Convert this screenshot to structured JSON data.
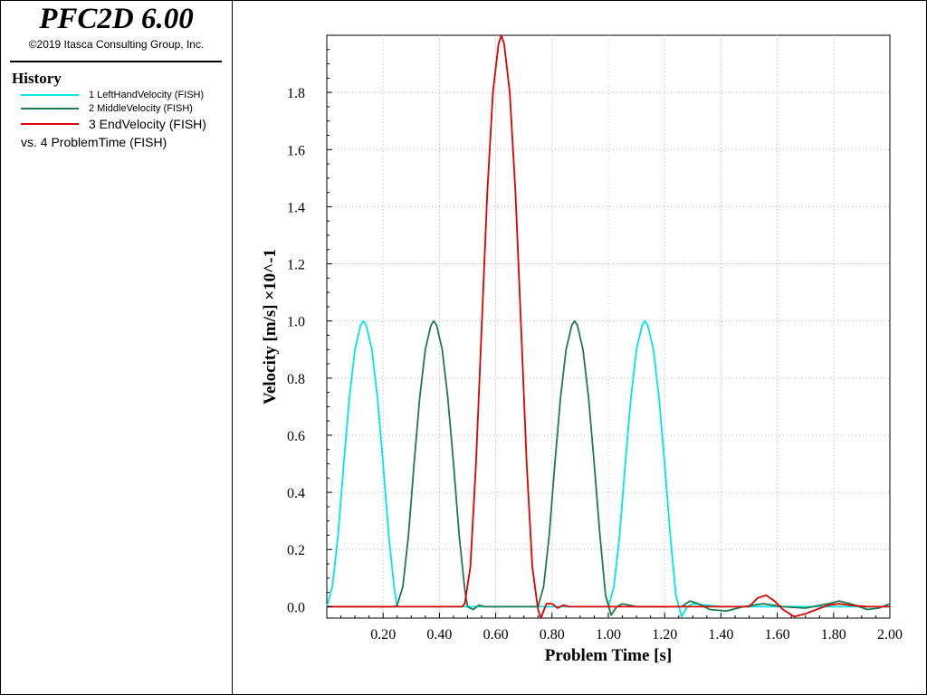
{
  "header": {
    "app_title": "PFC2D 6.00",
    "copyright": "©2019 Itasca Consulting Group, Inc."
  },
  "legend": {
    "heading": "History",
    "items": [
      {
        "label": "1 LeftHandVelocity (FISH)",
        "color": "#00e5e5"
      },
      {
        "label": "2 MiddleVelocity (FISH)",
        "color": "#1f7a4c"
      },
      {
        "label": "3 EndVelocity (FISH)",
        "color": "#dd0000"
      }
    ],
    "vs_label": "vs. 4 ProblemTime (FISH)"
  },
  "chart_data": {
    "type": "line",
    "xlabel": "Problem Time [s]",
    "ylabel": "Velocity [m/s] ×10^-1",
    "xlim": [
      0,
      2.0
    ],
    "ylim": [
      -0.04,
      2.0
    ],
    "x_ticks": [
      "0.20",
      "0.40",
      "0.60",
      "0.80",
      "1.00",
      "1.20",
      "1.40",
      "1.60",
      "1.80",
      "2.00"
    ],
    "y_ticks": [
      "0.0",
      "0.2",
      "0.4",
      "0.6",
      "0.8",
      "1.0",
      "1.2",
      "1.4",
      "1.6",
      "1.8"
    ],
    "grid": true,
    "series": [
      {
        "name": "1 LeftHandVelocity (FISH)",
        "color": "#00e5e5",
        "points": [
          [
            0.0,
            0.0
          ],
          [
            0.02,
            0.07
          ],
          [
            0.04,
            0.25
          ],
          [
            0.06,
            0.5
          ],
          [
            0.08,
            0.73
          ],
          [
            0.1,
            0.9
          ],
          [
            0.12,
            0.985
          ],
          [
            0.13,
            1.0
          ],
          [
            0.14,
            0.985
          ],
          [
            0.16,
            0.9
          ],
          [
            0.18,
            0.73
          ],
          [
            0.2,
            0.5
          ],
          [
            0.22,
            0.25
          ],
          [
            0.24,
            0.06
          ],
          [
            0.25,
            0.0
          ],
          [
            0.3,
            0.0
          ],
          [
            1.0,
            0.0
          ],
          [
            1.02,
            0.07
          ],
          [
            1.04,
            0.25
          ],
          [
            1.06,
            0.5
          ],
          [
            1.08,
            0.73
          ],
          [
            1.1,
            0.9
          ],
          [
            1.12,
            0.985
          ],
          [
            1.13,
            1.0
          ],
          [
            1.14,
            0.985
          ],
          [
            1.16,
            0.9
          ],
          [
            1.18,
            0.73
          ],
          [
            1.2,
            0.5
          ],
          [
            1.22,
            0.25
          ],
          [
            1.24,
            0.04
          ],
          [
            1.26,
            -0.035
          ],
          [
            1.28,
            0.0
          ],
          [
            1.3,
            0.01
          ],
          [
            1.4,
            0.0
          ],
          [
            2.0,
            0.0
          ]
        ]
      },
      {
        "name": "2 MiddleVelocity (FISH)",
        "color": "#1f7a4c",
        "points": [
          [
            0.0,
            0.0
          ],
          [
            0.24,
            0.0
          ],
          [
            0.25,
            0.005
          ],
          [
            0.27,
            0.07
          ],
          [
            0.29,
            0.25
          ],
          [
            0.31,
            0.5
          ],
          [
            0.33,
            0.73
          ],
          [
            0.35,
            0.9
          ],
          [
            0.37,
            0.985
          ],
          [
            0.38,
            1.0
          ],
          [
            0.39,
            0.985
          ],
          [
            0.41,
            0.9
          ],
          [
            0.43,
            0.73
          ],
          [
            0.45,
            0.5
          ],
          [
            0.47,
            0.25
          ],
          [
            0.49,
            0.06
          ],
          [
            0.5,
            0.0
          ],
          [
            0.52,
            -0.01
          ],
          [
            0.54,
            0.005
          ],
          [
            0.56,
            0.0
          ],
          [
            0.75,
            0.0
          ],
          [
            0.77,
            0.07
          ],
          [
            0.79,
            0.25
          ],
          [
            0.81,
            0.5
          ],
          [
            0.83,
            0.73
          ],
          [
            0.85,
            0.9
          ],
          [
            0.87,
            0.985
          ],
          [
            0.88,
            1.0
          ],
          [
            0.89,
            0.985
          ],
          [
            0.91,
            0.9
          ],
          [
            0.93,
            0.73
          ],
          [
            0.95,
            0.5
          ],
          [
            0.97,
            0.25
          ],
          [
            0.99,
            0.04
          ],
          [
            1.01,
            -0.03
          ],
          [
            1.03,
            0.0
          ],
          [
            1.05,
            0.01
          ],
          [
            1.1,
            0.0
          ],
          [
            1.26,
            0.0
          ],
          [
            1.29,
            0.02
          ],
          [
            1.32,
            0.01
          ],
          [
            1.36,
            -0.01
          ],
          [
            1.42,
            -0.015
          ],
          [
            1.48,
            0.0
          ],
          [
            1.55,
            0.01
          ],
          [
            1.62,
            0.0
          ],
          [
            1.7,
            -0.005
          ],
          [
            1.78,
            0.01
          ],
          [
            1.82,
            0.02
          ],
          [
            1.86,
            0.01
          ],
          [
            1.92,
            -0.01
          ],
          [
            1.96,
            -0.005
          ],
          [
            2.0,
            0.01
          ]
        ]
      },
      {
        "name": "3 EndVelocity (FISH)",
        "color": "#dd0000",
        "points": [
          [
            0.0,
            0.0
          ],
          [
            0.48,
            0.0
          ],
          [
            0.49,
            0.01
          ],
          [
            0.51,
            0.14
          ],
          [
            0.53,
            0.5
          ],
          [
            0.55,
            0.98
          ],
          [
            0.57,
            1.45
          ],
          [
            0.59,
            1.8
          ],
          [
            0.61,
            1.97
          ],
          [
            0.62,
            2.0
          ],
          [
            0.63,
            1.97
          ],
          [
            0.65,
            1.8
          ],
          [
            0.67,
            1.45
          ],
          [
            0.69,
            0.98
          ],
          [
            0.71,
            0.5
          ],
          [
            0.73,
            0.14
          ],
          [
            0.75,
            -0.01
          ],
          [
            0.76,
            -0.04
          ],
          [
            0.78,
            0.01
          ],
          [
            0.8,
            0.01
          ],
          [
            0.82,
            -0.005
          ],
          [
            0.84,
            0.005
          ],
          [
            0.86,
            0.0
          ],
          [
            1.2,
            0.0
          ],
          [
            1.5,
            0.0
          ],
          [
            1.53,
            0.03
          ],
          [
            1.56,
            0.04
          ],
          [
            1.59,
            0.02
          ],
          [
            1.62,
            -0.01
          ],
          [
            1.66,
            -0.035
          ],
          [
            1.7,
            -0.025
          ],
          [
            1.74,
            -0.01
          ],
          [
            1.78,
            0.005
          ],
          [
            1.82,
            0.01
          ],
          [
            1.86,
            0.005
          ],
          [
            1.92,
            0.0
          ],
          [
            2.0,
            0.0
          ]
        ]
      }
    ]
  }
}
